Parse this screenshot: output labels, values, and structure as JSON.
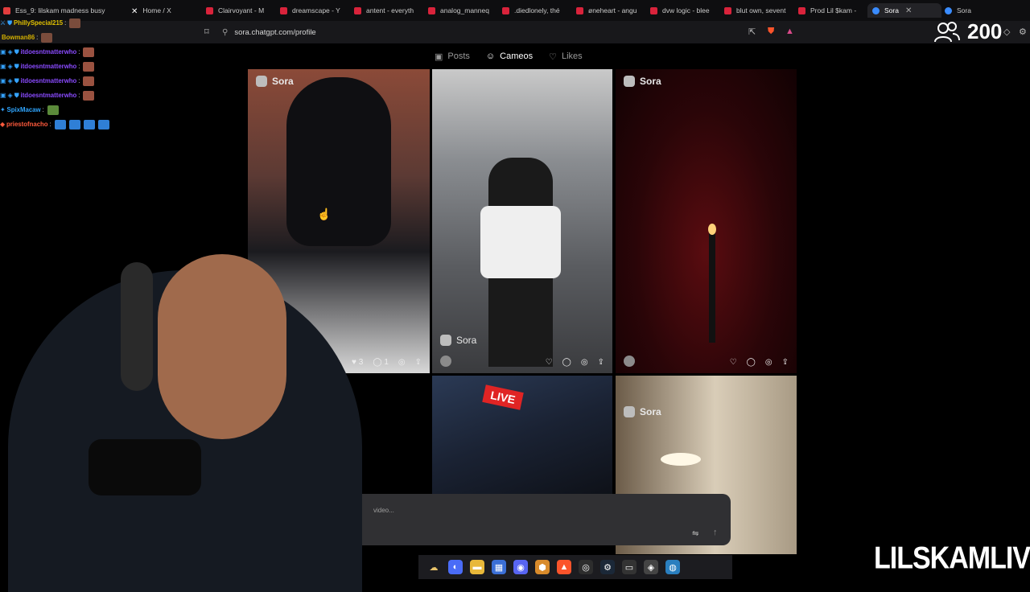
{
  "browser": {
    "tabs": [
      {
        "label": "Ess_9: lilskam madness busy",
        "color": "#e23d3d"
      },
      {
        "label": "Home / X",
        "color": "#ffffff"
      },
      {
        "label": "Clairvoyant - M",
        "color": "#d9233b"
      },
      {
        "label": "dreamscape - Y",
        "color": "#d9233b"
      },
      {
        "label": "antent - everyth",
        "color": "#d9233b"
      },
      {
        "label": "analog_manneq",
        "color": "#d9233b"
      },
      {
        "label": ".diedlonely, thé",
        "color": "#d9233b"
      },
      {
        "label": "øneheart - angu",
        "color": "#d9233b"
      },
      {
        "label": "dvw logic - blee",
        "color": "#d9233b"
      },
      {
        "label": "blut own, sevent",
        "color": "#d9233b"
      },
      {
        "label": "Prod Lil $kam -",
        "color": "#d9233b"
      },
      {
        "label": "Sora",
        "color": "#3a8cff"
      },
      {
        "label": "Sora",
        "color": "#3a8cff"
      }
    ],
    "url": "sora.chatgpt.com/profile"
  },
  "sora": {
    "tabs": [
      {
        "label": "Posts",
        "icon": "play-icon"
      },
      {
        "label": "Cameos",
        "icon": "face-icon"
      },
      {
        "label": "Likes",
        "icon": "heart-icon"
      }
    ],
    "active_tab": "Cameos",
    "brand": "Sora",
    "post1": {
      "likes": "3",
      "comments": "1"
    },
    "live_label": "LIVE",
    "prompt_placeholder": "video..."
  },
  "chat": [
    {
      "user": "PhillySpecial215",
      "color": "#e0c000",
      "badges": "⚔ ⛊"
    },
    {
      "user": "Bowman86",
      "color": "#d4b000",
      "badges": ""
    },
    {
      "user": "itdoesntmatterwho",
      "color": "#8a4bff",
      "badges": "▣ ◈ ⛊"
    },
    {
      "user": "itdoesntmatterwho",
      "color": "#8a4bff",
      "badges": "▣ ◈ ⛊"
    },
    {
      "user": "itdoesntmatterwho",
      "color": "#8a4bff",
      "badges": "▣ ◈ ⛊"
    },
    {
      "user": "itdoesntmatterwho",
      "color": "#8a4bff",
      "badges": "▣ ◈ ⛊"
    },
    {
      "user": "SpixMacaw",
      "color": "#2fa6ff",
      "badges": "✦"
    },
    {
      "user": "priestofnacho",
      "color": "#ff5a3c",
      "badges": "◆"
    }
  ],
  "stream": {
    "viewer_count": "200",
    "watermark": "LILSKAMLIVE"
  }
}
